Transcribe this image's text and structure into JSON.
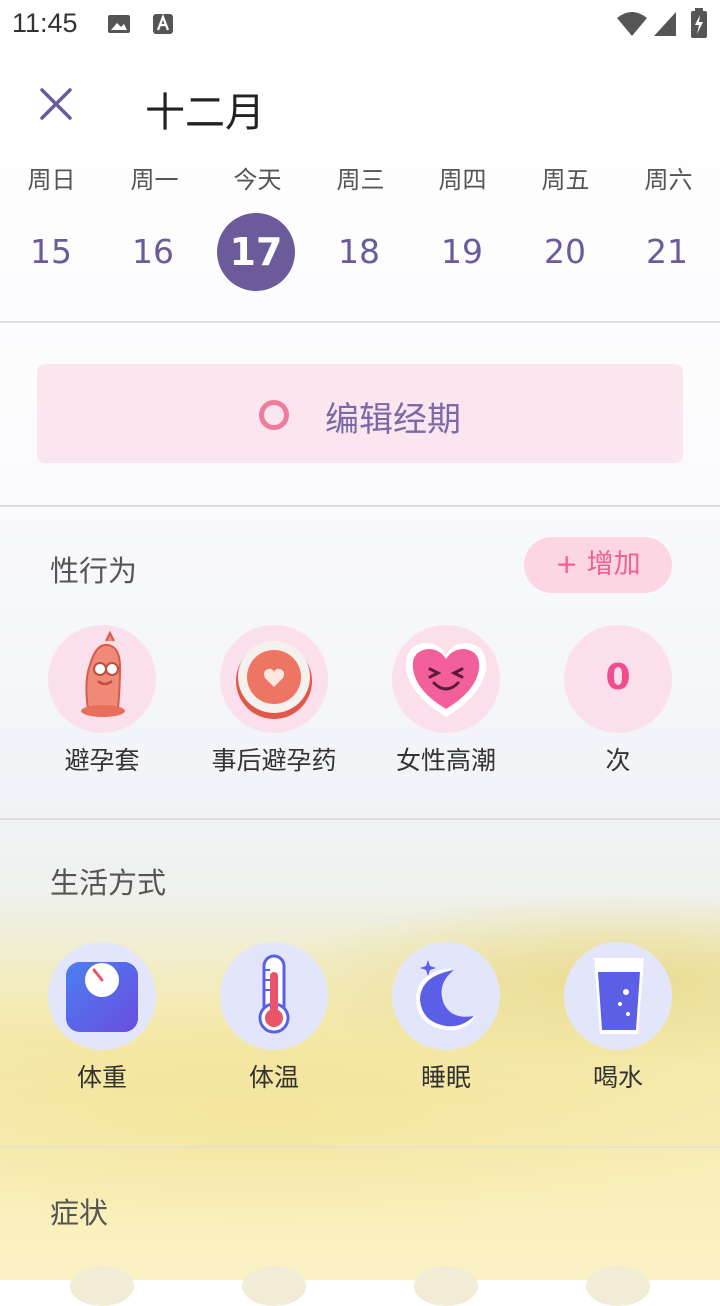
{
  "status_bar": {
    "time": "11:45"
  },
  "header": {
    "month": "十二月"
  },
  "week": {
    "days": [
      "周日",
      "周一",
      "今天",
      "周三",
      "周四",
      "周五",
      "周六"
    ],
    "dates": [
      "15",
      "16",
      "17",
      "18",
      "19",
      "20",
      "21"
    ],
    "today_index": 2
  },
  "period": {
    "label": "编辑经期"
  },
  "sex": {
    "title": "性行为",
    "add_label": "+ 增加",
    "items": [
      {
        "label": "避孕套",
        "icon": "condom-icon"
      },
      {
        "label": "事后避孕药",
        "icon": "pill-icon"
      },
      {
        "label": "女性高潮",
        "icon": "heart-face-icon"
      },
      {
        "label": "次",
        "value": "0"
      }
    ]
  },
  "lifestyle": {
    "title": "生活方式",
    "items": [
      {
        "label": "体重",
        "icon": "scale-icon"
      },
      {
        "label": "体温",
        "icon": "thermometer-icon"
      },
      {
        "label": "睡眠",
        "icon": "moon-icon"
      },
      {
        "label": "喝水",
        "icon": "water-glass-icon"
      }
    ]
  },
  "symptoms": {
    "title": "症状"
  },
  "colors": {
    "primary": "#6b5b9a",
    "pink_accent": "#f04c8e",
    "period_card": "#fbe6ef"
  }
}
